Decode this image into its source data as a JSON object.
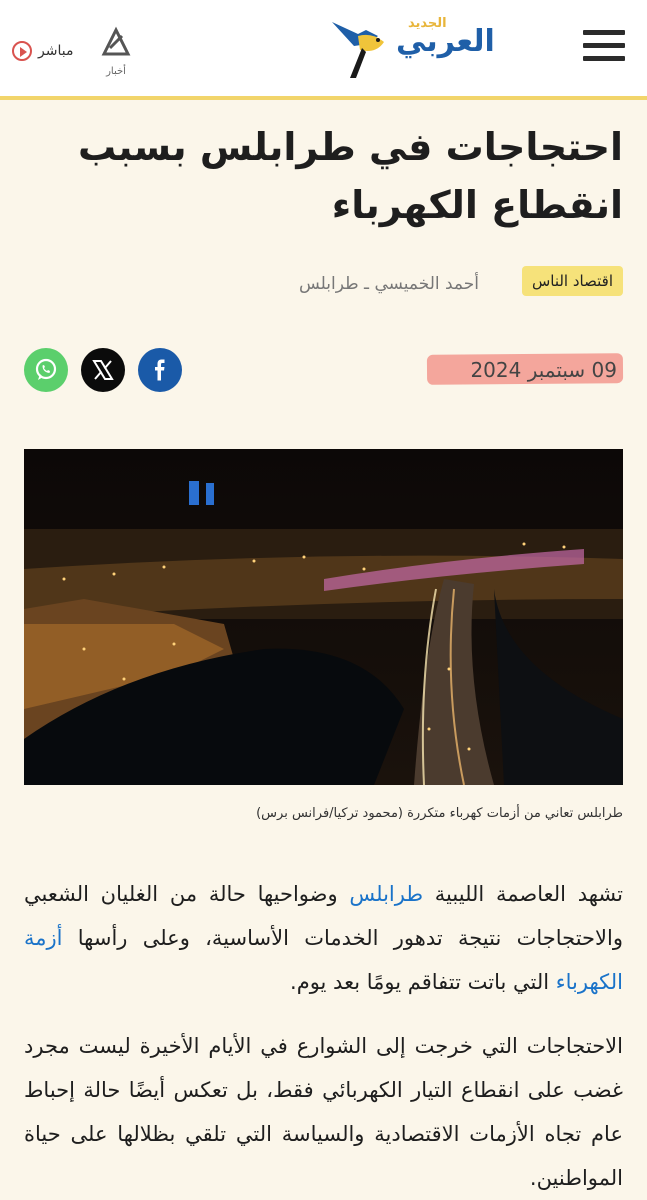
{
  "header": {
    "logo_main": "العربي",
    "logo_sub": "الجديد",
    "live_label": "مباشر",
    "news_logo_label": "أخبار"
  },
  "article": {
    "title": "احتجاجات في طرابلس بسبب انقطاع الكهرباء",
    "category": "اقتصاد الناس",
    "byline": "أحمد الخميسي ـ طرابلس",
    "date": "09 سبتمبر 2024",
    "caption": "طرابلس تعاني من أزمات كهرباء متكررة (محمود تركيا/فرانس برس)",
    "p1_a": "تشهد العاصمة الليبية ",
    "p1_link1": "طرابلس",
    "p1_b": " وضواحيها حالة من الغليان الشعبي والاحتجاجات نتيجة تدهور الخدمات الأساسية، وعلى رأسها ",
    "p1_link2": "أزمة الكهرباء",
    "p1_c": " التي باتت تتفاقم يومًا بعد يوم.",
    "p2": "الاحتجاجات التي خرجت إلى الشوارع في الأيام الأخيرة ليست مجرد غضب على انقطاع التيار الكهربائي فقط، بل تعكس أيضًا حالة إحباط عام تجاه الأزمات الاقتصادية والسياسة التي تلقي بظلالها على حياة المواطنين."
  },
  "share": {
    "facebook_icon": "facebook-icon",
    "x_icon": "x-icon",
    "whatsapp_icon": "whatsapp-icon"
  },
  "colors": {
    "brand_blue": "#1f5fa8",
    "accent_yellow": "#f2d56b",
    "badge_yellow": "#f6e27a",
    "highlight_red": "#f28b82",
    "link_blue": "#1a73c9"
  }
}
